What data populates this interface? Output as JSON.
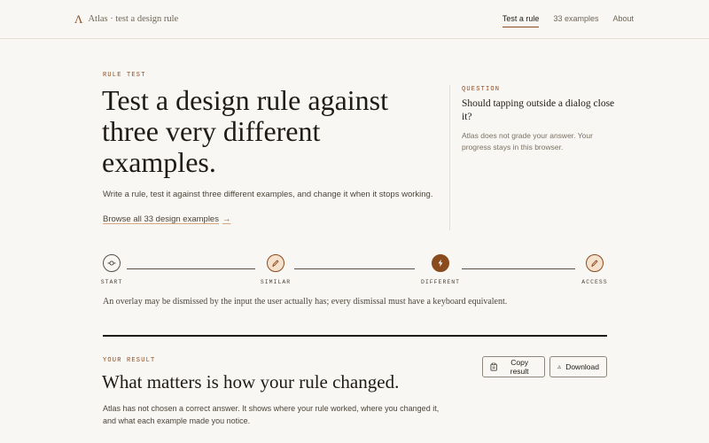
{
  "header": {
    "brand_mark": "Λ",
    "brand_label": "Atlas · test a design rule",
    "nav": [
      "Test a rule",
      "33 examples",
      "About"
    ],
    "active_nav": "Test a rule"
  },
  "hero": {
    "eyebrow": "RULE TEST",
    "title": "Test a design rule against three very different examples.",
    "intro": "Write a rule, test it against three different examples, and change it when it stops working.",
    "browse_link": "Browse all 33 design examples",
    "browse_arrow": "→"
  },
  "question": {
    "label": "QUESTION",
    "text": "Should tapping outside a dialog close it?",
    "note": "Atlas does not grade your answer. Your progress stays in this browser."
  },
  "steps": [
    {
      "label": "START",
      "icon": "branch-icon",
      "state": "done"
    },
    {
      "label": "SIMILAR",
      "icon": "pencil-icon",
      "state": "visited"
    },
    {
      "label": "DIFFERENT",
      "icon": "lightning-icon",
      "state": "current"
    },
    {
      "label": "ACCESS",
      "icon": "pencil-icon",
      "state": "visited"
    }
  ],
  "rule": "An overlay may be dismissed by the input the user actually has; every dismissal must have a keyboard equivalent.",
  "result": {
    "eyebrow": "YOUR RESULT",
    "title": "What matters is how your rule changed.",
    "text": "Atlas has not chosen a correct answer. It shows where your rule worked, where you changed it, and what each example made you notice.",
    "copy_label": "Copy result",
    "download_label": "Download"
  },
  "colors": {
    "accent": "#8a4b1f",
    "accent_light": "#f6e1cc",
    "background": "#f9f7f3",
    "text": "#1f1b16"
  }
}
